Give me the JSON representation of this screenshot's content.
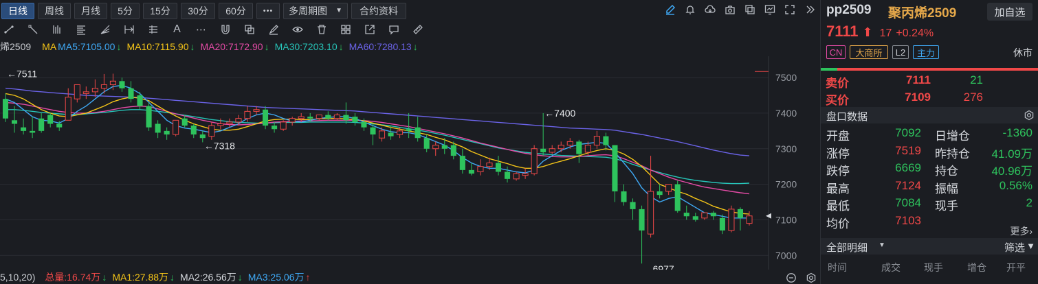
{
  "toolbar": {
    "periods": [
      "日线",
      "周线",
      "月线",
      "5分",
      "15分",
      "30分",
      "60分"
    ],
    "active_period": "日线",
    "more": "•••",
    "multi_period": "多周期图",
    "contract_info": "合约资料"
  },
  "ma_line": {
    "prefix": "烯2509",
    "ma": "MA",
    "ma5": "MA5:7105.00",
    "ma10": "MA10:7115.90",
    "ma20": "MA20:7172.90",
    "ma30": "MA30:7203.10",
    "ma60": "MA60:7280.13"
  },
  "volume_line": {
    "params": "5,10,20)",
    "total": "总量:16.74万",
    "ma1": "MA1:27.88万",
    "ma2": "MA2:26.56万",
    "ma3": "MA3:25.06万"
  },
  "colors": {
    "up": "#f04848",
    "down": "#2ec35d",
    "ma5": "#3fa9f5",
    "ma10": "#f5c518",
    "ma20": "#e54ba6",
    "ma30": "#27c4b8",
    "ma60": "#6b63e8"
  },
  "chart_data": {
    "type": "candlestick",
    "y_ticks": [
      "7500",
      "7400",
      "7300",
      "7200",
      "7100",
      "7000"
    ],
    "ylim": [
      6960,
      7560
    ],
    "annotations": [
      {
        "text": "←7511",
        "value": 7511
      },
      {
        "text": "←7400",
        "value": 7400
      },
      {
        "text": "←7318",
        "value": 7318
      },
      {
        "text": "←6977",
        "value": 6977
      }
    ],
    "candles": [
      [
        7440,
        7455,
        7385,
        7375
      ],
      [
        7380,
        7420,
        7370,
        7345
      ],
      [
        7360,
        7385,
        7350,
        7340
      ],
      [
        7350,
        7390,
        7345,
        7330
      ],
      [
        7385,
        7400,
        7350,
        7345
      ],
      [
        7395,
        7400,
        7370,
        7360
      ],
      [
        7370,
        7378,
        7360,
        7350
      ],
      [
        7380,
        7470,
        7445,
        7380
      ],
      [
        7440,
        7465,
        7480,
        7430
      ],
      [
        7455,
        7475,
        7460,
        7440
      ],
      [
        7460,
        7495,
        7470,
        7445
      ],
      [
        7470,
        7510,
        7480,
        7455
      ],
      [
        7480,
        7511,
        7490,
        7465
      ],
      [
        7490,
        7500,
        7470,
        7460
      ],
      [
        7470,
        7490,
        7440,
        7430
      ],
      [
        7450,
        7460,
        7420,
        7410
      ],
      [
        7420,
        7430,
        7360,
        7350
      ],
      [
        7370,
        7380,
        7345,
        7330
      ],
      [
        7350,
        7360,
        7340,
        7325
      ],
      [
        7340,
        7360,
        7380,
        7335
      ],
      [
        7385,
        7395,
        7365,
        7360
      ],
      [
        7365,
        7370,
        7340,
        7330
      ],
      [
        7340,
        7350,
        7330,
        7318
      ],
      [
        7335,
        7375,
        7365,
        7325
      ],
      [
        7365,
        7385,
        7370,
        7355
      ],
      [
        7370,
        7385,
        7375,
        7360
      ],
      [
        7375,
        7395,
        7385,
        7365
      ],
      [
        7385,
        7420,
        7405,
        7375
      ],
      [
        7405,
        7420,
        7410,
        7395
      ],
      [
        7410,
        7420,
        7365,
        7355
      ],
      [
        7365,
        7375,
        7355,
        7345
      ],
      [
        7355,
        7380,
        7375,
        7350
      ],
      [
        7375,
        7390,
        7385,
        7365
      ],
      [
        7385,
        7400,
        7390,
        7375
      ],
      [
        7390,
        7400,
        7385,
        7375
      ],
      [
        7385,
        7395,
        7395,
        7380
      ],
      [
        7395,
        7405,
        7385,
        7380
      ],
      [
        7385,
        7400,
        7395,
        7380
      ],
      [
        7395,
        7430,
        7380,
        7370
      ],
      [
        7390,
        7400,
        7375,
        7365
      ],
      [
        7375,
        7385,
        7360,
        7350
      ],
      [
        7360,
        7370,
        7340,
        7310
      ],
      [
        7330,
        7360,
        7350,
        7320
      ],
      [
        7345,
        7365,
        7335,
        7325
      ],
      [
        7340,
        7360,
        7350,
        7330
      ],
      [
        7355,
        7400,
        7350,
        7330
      ],
      [
        7360,
        7390,
        7330,
        7320
      ],
      [
        7330,
        7340,
        7300,
        7290
      ],
      [
        7300,
        7320,
        7310,
        7280
      ],
      [
        7310,
        7330,
        7300,
        7285
      ],
      [
        7310,
        7320,
        7280,
        7270
      ],
      [
        7280,
        7300,
        7240,
        7230
      ],
      [
        7240,
        7260,
        7230,
        7225
      ],
      [
        7235,
        7270,
        7250,
        7225
      ],
      [
        7250,
        7275,
        7260,
        7240
      ],
      [
        7260,
        7280,
        7235,
        7225
      ],
      [
        7235,
        7250,
        7215,
        7205
      ],
      [
        7215,
        7235,
        7230,
        7210
      ],
      [
        7225,
        7245,
        7230,
        7215
      ],
      [
        7230,
        7310,
        7300,
        7225
      ],
      [
        7300,
        7400,
        7290,
        7280
      ],
      [
        7290,
        7310,
        7300,
        7285
      ],
      [
        7300,
        7320,
        7310,
        7290
      ],
      [
        7310,
        7330,
        7320,
        7300
      ],
      [
        7320,
        7325,
        7285,
        7260
      ],
      [
        7290,
        7320,
        7310,
        7280
      ],
      [
        7310,
        7350,
        7335,
        7300
      ],
      [
        7335,
        7345,
        7310,
        7295
      ],
      [
        7310,
        7240,
        7180,
        7150
      ],
      [
        7180,
        7200,
        7150,
        7140
      ],
      [
        7150,
        7160,
        7130,
        7100
      ],
      [
        7130,
        7140,
        7070,
        6977
      ],
      [
        7060,
        7280,
        7180,
        7050
      ],
      [
        7180,
        7200,
        7170,
        7160
      ],
      [
        7180,
        7200,
        7200,
        7170
      ],
      [
        7200,
        7210,
        7125,
        7120
      ],
      [
        7120,
        7140,
        7110,
        7100
      ],
      [
        7110,
        7120,
        7100,
        7095
      ],
      [
        7105,
        7120,
        7120,
        7100
      ],
      [
        7120,
        7125,
        7110,
        7100
      ],
      [
        7105,
        7115,
        7070,
        7060
      ],
      [
        7070,
        7140,
        7130,
        7065
      ],
      [
        7130,
        7135,
        7105,
        7070
      ],
      [
        7090,
        7124,
        7111,
        7084
      ]
    ],
    "ma5": [
      7440,
      7430,
      7410,
      7390,
      7380,
      7378,
      7372,
      7385,
      7405,
      7420,
      7440,
      7460,
      7475,
      7478,
      7470,
      7455,
      7430,
      7405,
      7380,
      7365,
      7358,
      7355,
      7350,
      7345,
      7350,
      7360,
      7370,
      7385,
      7395,
      7400,
      7395,
      7385,
      7378,
      7375,
      7380,
      7385,
      7388,
      7390,
      7390,
      7385,
      7375,
      7365,
      7355,
      7348,
      7345,
      7345,
      7340,
      7330,
      7320,
      7310,
      7295,
      7275,
      7260,
      7250,
      7245,
      7245,
      7240,
      7235,
      7232,
      7240,
      7265,
      7280,
      7295,
      7305,
      7312,
      7315,
      7318,
      7315,
      7290,
      7260,
      7230,
      7190,
      7165,
      7150,
      7160,
      7165,
      7150,
      7135,
      7120,
      7115,
      7110,
      7105,
      7105,
      7105
    ],
    "ma10": [
      7455,
      7450,
      7440,
      7425,
      7410,
      7400,
      7392,
      7390,
      7395,
      7400,
      7410,
      7420,
      7432,
      7440,
      7445,
      7442,
      7435,
      7420,
      7405,
      7392,
      7380,
      7370,
      7362,
      7355,
      7352,
      7352,
      7355,
      7362,
      7370,
      7378,
      7382,
      7383,
      7383,
      7382,
      7382,
      7384,
      7385,
      7385,
      7384,
      7382,
      7378,
      7372,
      7366,
      7360,
      7355,
      7350,
      7345,
      7340,
      7332,
      7325,
      7315,
      7305,
      7292,
      7282,
      7272,
      7265,
      7258,
      7250,
      7245,
      7245,
      7250,
      7258,
      7265,
      7272,
      7280,
      7288,
      7295,
      7300,
      7295,
      7285,
      7270,
      7250,
      7225,
      7200,
      7190,
      7180,
      7172,
      7160,
      7150,
      7138,
      7130,
      7122,
      7118,
      7116
    ],
    "ma20": [
      7430,
      7428,
      7425,
      7420,
      7415,
      7410,
      7405,
      7402,
      7400,
      7400,
      7402,
      7405,
      7410,
      7415,
      7418,
      7420,
      7418,
      7412,
      7405,
      7398,
      7392,
      7386,
      7380,
      7375,
      7370,
      7368,
      7367,
      7368,
      7370,
      7372,
      7375,
      7376,
      7377,
      7378,
      7378,
      7379,
      7380,
      7380,
      7380,
      7380,
      7379,
      7377,
      7374,
      7370,
      7366,
      7362,
      7357,
      7352,
      7347,
      7342,
      7336,
      7330,
      7323,
      7316,
      7310,
      7304,
      7298,
      7292,
      7287,
      7283,
      7280,
      7278,
      7277,
      7277,
      7278,
      7280,
      7282,
      7283,
      7280,
      7272,
      7262,
      7252,
      7240,
      7230,
      7220,
      7212,
      7205,
      7198,
      7192,
      7188,
      7184,
      7180,
      7176,
      7173
    ],
    "ma30": [
      7410,
      7410,
      7408,
      7405,
      7402,
      7400,
      7398,
      7396,
      7396,
      7398,
      7400,
      7402,
      7405,
      7408,
      7410,
      7410,
      7408,
      7405,
      7402,
      7398,
      7394,
      7390,
      7386,
      7382,
      7379,
      7376,
      7374,
      7373,
      7372,
      7372,
      7373,
      7374,
      7374,
      7374,
      7375,
      7375,
      7375,
      7375,
      7375,
      7374,
      7372,
      7370,
      7367,
      7364,
      7360,
      7356,
      7352,
      7348,
      7343,
      7338,
      7332,
      7326,
      7320,
      7314,
      7308,
      7302,
      7298,
      7294,
      7290,
      7287,
      7285,
      7283,
      7281,
      7280,
      7279,
      7278,
      7277,
      7276,
      7272,
      7265,
      7256,
      7248,
      7240,
      7233,
      7226,
      7220,
      7215,
      7211,
      7208,
      7205,
      7203,
      7202,
      7202,
      7203
    ],
    "ma60": [
      7470,
      7468,
      7465,
      7462,
      7460,
      7458,
      7456,
      7454,
      7452,
      7450,
      7449,
      7448,
      7447,
      7446,
      7445,
      7444,
      7442,
      7440,
      7438,
      7436,
      7434,
      7432,
      7430,
      7428,
      7426,
      7424,
      7422,
      7420,
      7418,
      7416,
      7415,
      7414,
      7413,
      7412,
      7411,
      7410,
      7409,
      7408,
      7407,
      7406,
      7404,
      7402,
      7400,
      7398,
      7396,
      7394,
      7392,
      7390,
      7388,
      7386,
      7384,
      7382,
      7380,
      7378,
      7376,
      7374,
      7372,
      7370,
      7368,
      7366,
      7364,
      7362,
      7360,
      7358,
      7357,
      7356,
      7355,
      7354,
      7352,
      7348,
      7344,
      7340,
      7335,
      7330,
      7325,
      7320,
      7314,
      7308,
      7302,
      7296,
      7291,
      7286,
      7282,
      7280
    ]
  },
  "panel": {
    "symbol": "pp2509",
    "name": "聚丙烯2509",
    "add_button": "加自选",
    "price": "7111",
    "change": "17",
    "change_pct": "+0.24%",
    "badges": [
      "CN",
      "大商所",
      "L2",
      "主力"
    ],
    "market_status": "休市",
    "ask_label": "卖价",
    "ask_price": "7111",
    "ask_vol": "21",
    "bid_label": "买价",
    "bid_price": "7109",
    "bid_vol": "276",
    "section_title": "盘口数据",
    "stats": [
      {
        "label": "开盘",
        "value": "7092",
        "label2": "日增仓",
        "value2": "-1360"
      },
      {
        "label": "涨停",
        "value": "7519",
        "label2": "昨持仓",
        "value2": "41.09万"
      },
      {
        "label": "跌停",
        "value": "6669",
        "label2": "持仓",
        "value2": "40.96万"
      },
      {
        "label": "最高",
        "value": "7124",
        "label2": "振幅",
        "value2": "0.56%"
      },
      {
        "label": "最低",
        "value": "7084",
        "label2": "现手",
        "value2": "2"
      },
      {
        "label": "均价",
        "value": "7103",
        "label2": "",
        "value2": ""
      }
    ],
    "more": "更多›",
    "detail_title": "全部明细",
    "filter": "筛选",
    "columns": [
      "时间",
      "成交",
      "现手",
      "增仓",
      "开平"
    ]
  }
}
